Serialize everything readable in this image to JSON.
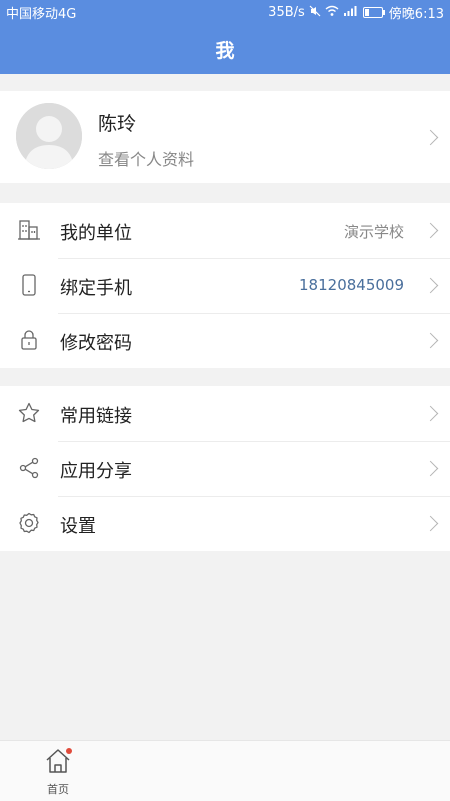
{
  "status_bar": {
    "carrier": "中国移动4G",
    "speed": "35B/s",
    "time": "傍晚6:13",
    "battery_level": 0.25
  },
  "header": {
    "title": "我"
  },
  "profile": {
    "name": "陈玲",
    "subtitle": "查看个人资料"
  },
  "group1": {
    "unit": {
      "label": "我的单位",
      "value": "演示学校",
      "icon": "building-icon"
    },
    "phone": {
      "label": "绑定手机",
      "value": "18120845009",
      "icon": "phone-icon"
    },
    "password": {
      "label": "修改密码",
      "icon": "lock-icon"
    }
  },
  "group2": {
    "links": {
      "label": "常用链接",
      "icon": "star-icon"
    },
    "share": {
      "label": "应用分享",
      "icon": "share-icon"
    },
    "settings": {
      "label": "设置",
      "icon": "gear-icon"
    }
  },
  "tabbar": {
    "home": {
      "label": "首页",
      "icon": "home-icon",
      "has_badge": true
    }
  },
  "colors": {
    "header_bg": "#5a8de0",
    "page_bg": "#f2f2f2",
    "phone_value": "#4a6f9c",
    "muted_value": "#888888",
    "badge": "#e04a3a"
  }
}
